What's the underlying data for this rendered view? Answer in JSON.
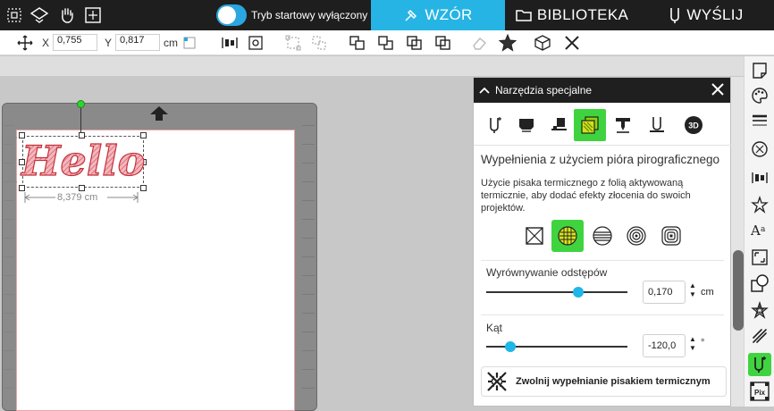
{
  "topbar": {
    "startup_mode_label": "Tryb startowy wyłączony",
    "tabs": [
      {
        "label": "WZÓR",
        "icon": "design-icon"
      },
      {
        "label": "BIBLIOTEKA",
        "icon": "folder-icon"
      },
      {
        "label": "WYŚLIJ",
        "icon": "send-icon"
      }
    ]
  },
  "toolbar": {
    "x_label": "X",
    "x_value": "0,755",
    "y_label": "Y",
    "y_value": "0,817",
    "unit": "cm"
  },
  "canvas": {
    "text_object": "Hello",
    "width_label": "8,379 cm"
  },
  "panel": {
    "title": "Narzędzia specjalne",
    "section_title": "Wypełnienia z użyciem pióra pirograficznego",
    "description": "Użycie pisaka termicznego z folią aktywowaną termicznie, aby dodać efekty złocenia do swoich projektów.",
    "spacing": {
      "label": "Wyrównywanie odstępów",
      "value": "0,170",
      "unit": "cm",
      "slider_level": 0.65
    },
    "angle": {
      "label": "Kąt",
      "value": "-120,0",
      "unit": "°",
      "slider_level": 0.17
    },
    "release_button_label": "Zwolnij wypełnianie pisakiem termicznym"
  },
  "colors": {
    "accent_blue": "#26b4e4",
    "active_green": "#3fd43f",
    "topbar_bg": "#1e1e1e"
  }
}
